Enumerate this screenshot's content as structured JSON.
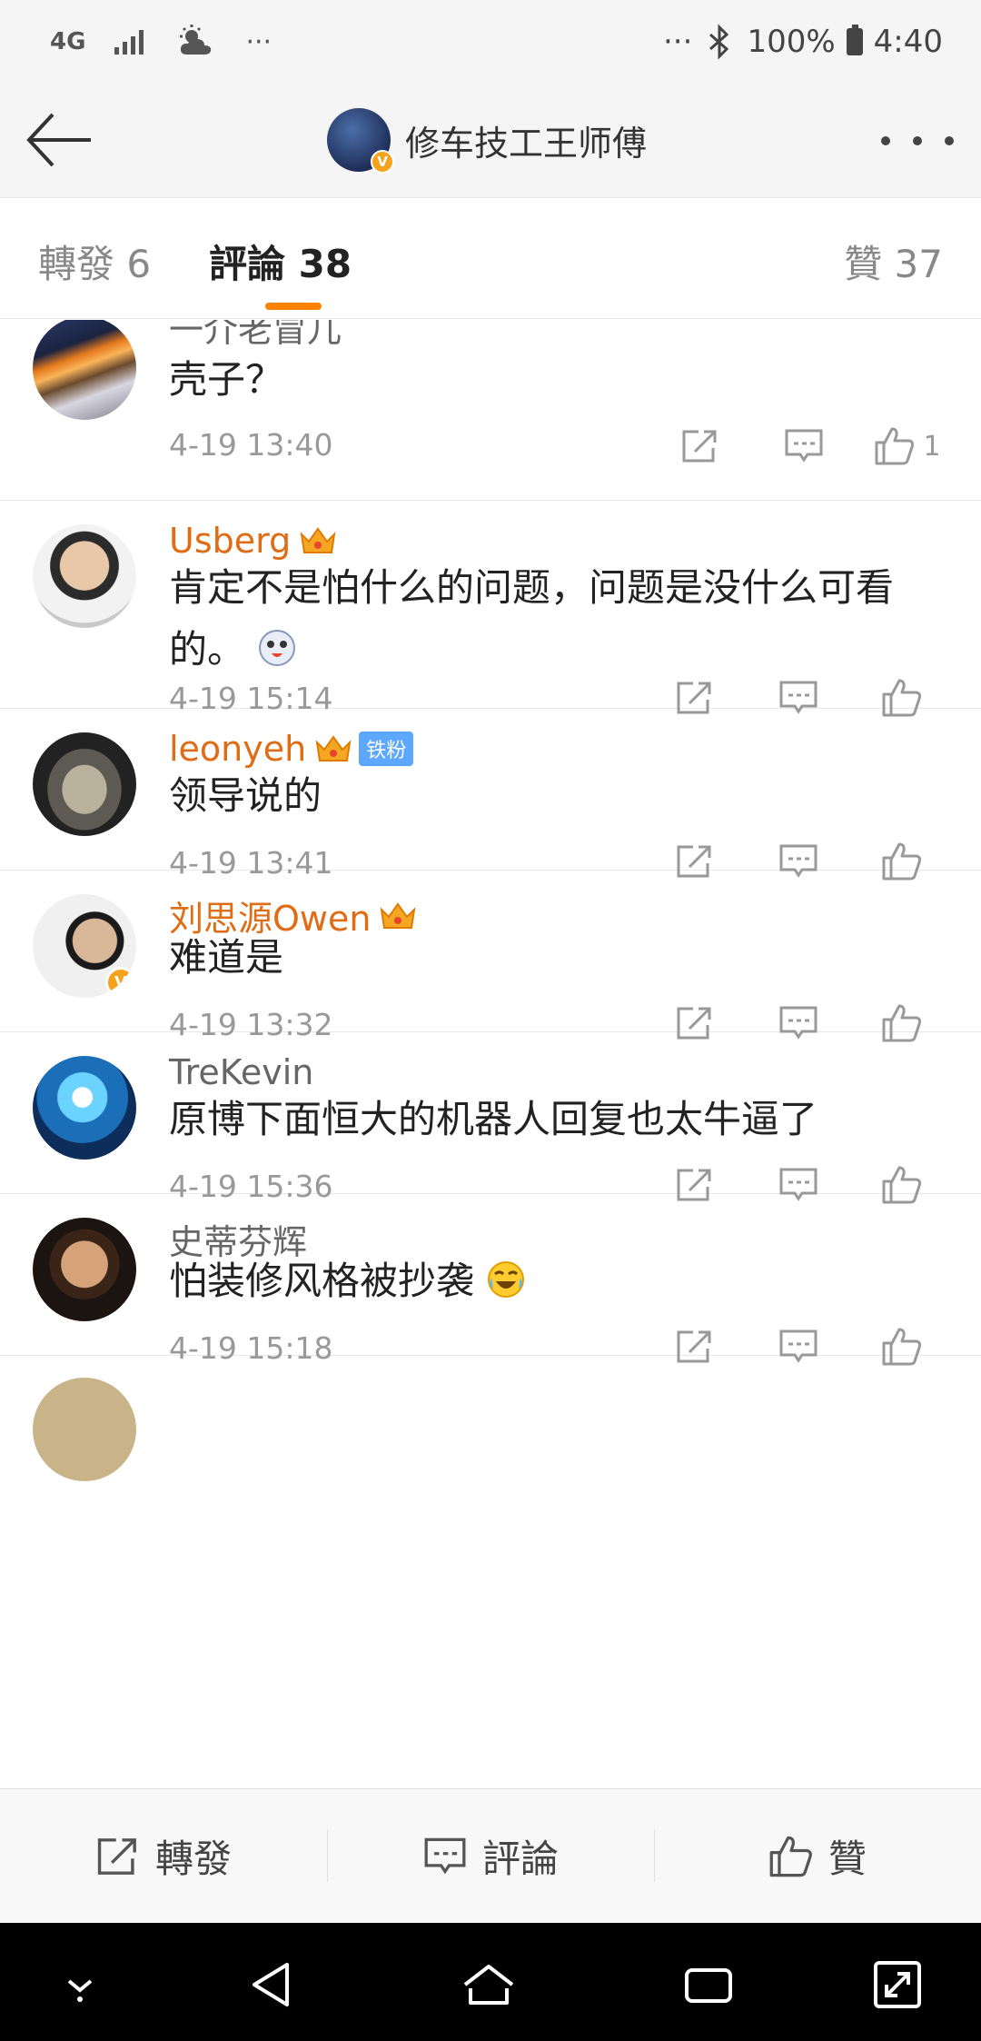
{
  "status_bar": {
    "network": "4G",
    "more_left": "···",
    "more_right": "···",
    "battery": "100%",
    "time": "4:40"
  },
  "header": {
    "title": "修车技工王师傅",
    "avatar_badge": "V"
  },
  "tabs": [
    {
      "label": "轉發 6"
    },
    {
      "label": "評論 38"
    },
    {
      "label": "贊 37"
    }
  ],
  "comments": [
    {
      "user": "一介老冒儿",
      "text": "壳子？",
      "time": "4-19 13:40",
      "likes": "1",
      "vip": false
    },
    {
      "user": "Usberg",
      "text": "肯定不是怕什么的问题，问题是没什么可看的。",
      "time": "4-19 15:14",
      "likes": "",
      "vip": true
    },
    {
      "user": "leonyeh",
      "badge": "铁粉",
      "text": "领导说的",
      "time": "4-19 13:41",
      "likes": "",
      "vip": true
    },
    {
      "user": "刘思源Owen",
      "text": "难道是",
      "time": "4-19 13:32",
      "likes": "",
      "vip": true,
      "verified": "V"
    },
    {
      "user": "TreKevin",
      "text": "原博下面恒大的机器人回复也太牛逼了",
      "time": "4-19 15:36",
      "likes": "",
      "vip": false
    },
    {
      "user": "史蒂芬辉",
      "text": "怕装修风格被抄袭",
      "time": "4-19 15:18",
      "likes": "",
      "vip": false
    }
  ],
  "bottom_bar": {
    "repost": "轉發",
    "comment": "評論",
    "like": "贊"
  },
  "colors": {
    "accent": "#ff8200",
    "vip_name": "#e06c15",
    "verified": "#f7a21b"
  },
  "icons": [
    "back-arrow-icon",
    "more-icon",
    "share-icon",
    "comment-icon",
    "like-icon",
    "bluetooth-icon",
    "signal-icon",
    "weather-icon"
  ]
}
